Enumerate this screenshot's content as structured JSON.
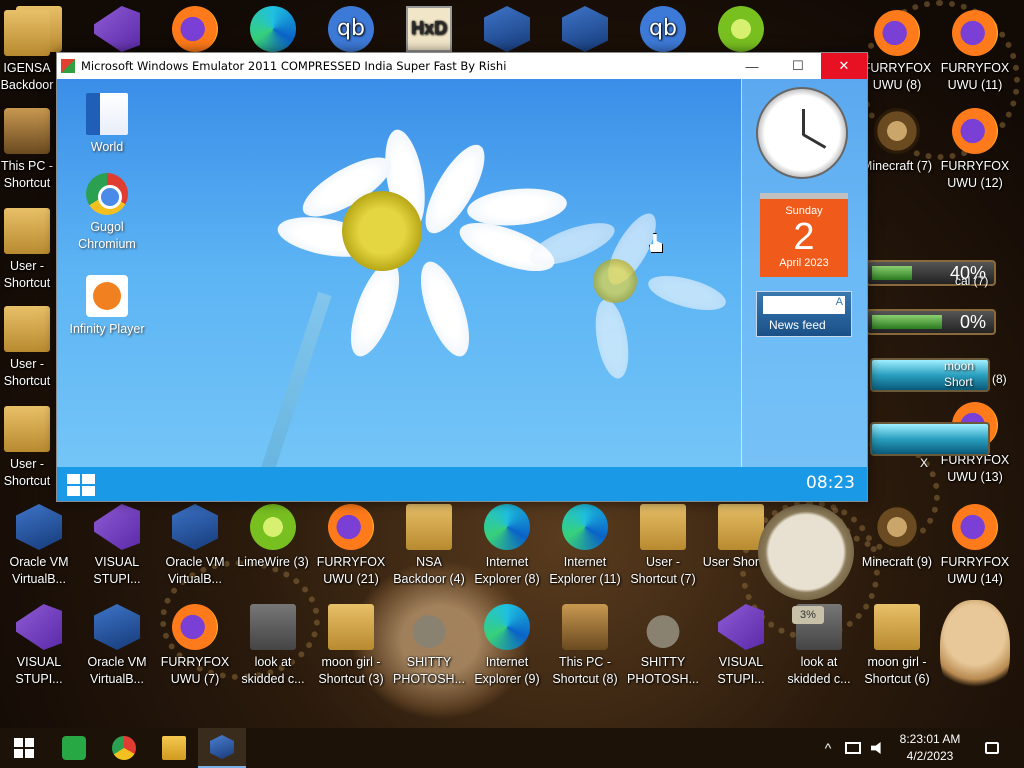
{
  "desktop": {
    "row1": [
      {
        "label": "",
        "icon": "folder-icon"
      },
      {
        "label": "",
        "icon": "visual-studio-icon"
      },
      {
        "label": "",
        "icon": "firefox-icon"
      },
      {
        "label": "",
        "icon": "edge-icon"
      },
      {
        "label": "",
        "icon": "qbittorrent-icon"
      },
      {
        "label": "",
        "icon": "hxd-icon"
      },
      {
        "label": "",
        "icon": "virtualbox-icon"
      },
      {
        "label": "",
        "icon": "virtualbox-icon"
      },
      {
        "label": "",
        "icon": "qbittorrent-icon"
      },
      {
        "label": "",
        "icon": "limewire-icon"
      }
    ],
    "left_column": [
      {
        "label": "IGENSA Backdoor",
        "icon": "folder-icon"
      },
      {
        "label": "This PC - Shortcut",
        "icon": "computer-icon"
      },
      {
        "label": "User - Shortcut",
        "icon": "user-folder-icon"
      },
      {
        "label": "User - Shortcut",
        "icon": "user-folder-icon"
      },
      {
        "label": "User - Shortcut",
        "icon": "user-folder-icon"
      }
    ],
    "right_column": [
      {
        "label": "FURRYFOX UWU (8)",
        "icon": "firefox-icon"
      },
      {
        "label": "FURRYFOX UWU (11)",
        "icon": "firefox-icon"
      },
      {
        "label": "Minecraft (7)",
        "icon": "minecraft-icon"
      },
      {
        "label": "FURRYFOX UWU (12)",
        "icon": "firefox-icon"
      },
      {
        "label": "FURRYFOX UWU (13)",
        "icon": "firefox-icon"
      }
    ],
    "row_bottom1": [
      {
        "label": "Oracle VM VirtualB...",
        "icon": "virtualbox-icon"
      },
      {
        "label": "VISUAL STUPI...",
        "icon": "visual-studio-icon"
      },
      {
        "label": "Oracle VM VirtualB...",
        "icon": "virtualbox-icon"
      },
      {
        "label": "LimeWire (3)",
        "icon": "limewire-icon"
      },
      {
        "label": "FURRYFOX UWU (21)",
        "icon": "firefox-icon"
      },
      {
        "label": "NSA Backdoor (4)",
        "icon": "folder-icon"
      },
      {
        "label": "Internet Explorer (8)",
        "icon": "edge-icon"
      },
      {
        "label": "Internet Explorer (11)",
        "icon": "edge-icon"
      },
      {
        "label": "User - Shortcut (7)",
        "icon": "user-folder-icon"
      },
      {
        "label": "User Shortcut",
        "icon": "user-folder-icon"
      },
      {
        "label": "Minecraft (9)",
        "icon": "minecraft-icon"
      },
      {
        "label": "FURRYFOX UWU (14)",
        "icon": "firefox-icon"
      }
    ],
    "row_bottom2": [
      {
        "label": "VISUAL STUPI...",
        "icon": "visual-studio-icon"
      },
      {
        "label": "Oracle VM VirtualB...",
        "icon": "virtualbox-icon"
      },
      {
        "label": "FURRYFOX UWU (7)",
        "icon": "firefox-icon"
      },
      {
        "label": "look at skidded c...",
        "icon": "windows-stack-icon"
      },
      {
        "label": "moon girl - Shortcut (3)",
        "icon": "user-folder-icon"
      },
      {
        "label": "SHITTY PHOTOSH...",
        "icon": "gimp-icon"
      },
      {
        "label": "Internet Explorer (9)",
        "icon": "edge-icon"
      },
      {
        "label": "This PC - Shortcut (8)",
        "icon": "computer-icon"
      },
      {
        "label": "SHITTY PHOTOSH...",
        "icon": "gimp-icon"
      },
      {
        "label": "VISUAL STUPI...",
        "icon": "visual-studio-icon"
      },
      {
        "label": "look at skidded c...",
        "icon": "windows-stack-icon"
      },
      {
        "label": "moon girl - Shortcut (6)",
        "icon": "user-folder-icon"
      }
    ],
    "widgets": {
      "meter1": "40%",
      "meter1_tail": "cal (7)",
      "meter2": "0%",
      "moon_label": "moon",
      "moon_sub": "Short",
      "moon_tail": "(8)",
      "x_mark": "X",
      "gauge_pct": "3%"
    }
  },
  "emulator": {
    "title": "Microsoft Windows Emulator 2011 COMPRESSED India Super Fast By Rishi",
    "minimize": "—",
    "maximize": "☐",
    "close": "✕",
    "icons": [
      {
        "label": "World",
        "icon": "word-icon"
      },
      {
        "label": "Gugol Chromium",
        "icon": "chrome-icon"
      },
      {
        "label": "Infinity Player",
        "icon": "media-player-icon"
      }
    ],
    "calendar": {
      "weekday": "Sunday",
      "day": "2",
      "month_year": "April 2023"
    },
    "news_label": "News feed",
    "news_letter": "A",
    "clock": "08:23"
  },
  "taskbar": {
    "apps": [
      "windows-start-icon",
      "green-app-icon",
      "chrome-icon",
      "file-explorer-icon",
      "virtualbox-icon"
    ],
    "tray_caret": "^",
    "time": "8:23:01 AM",
    "date": "4/2/2023"
  }
}
